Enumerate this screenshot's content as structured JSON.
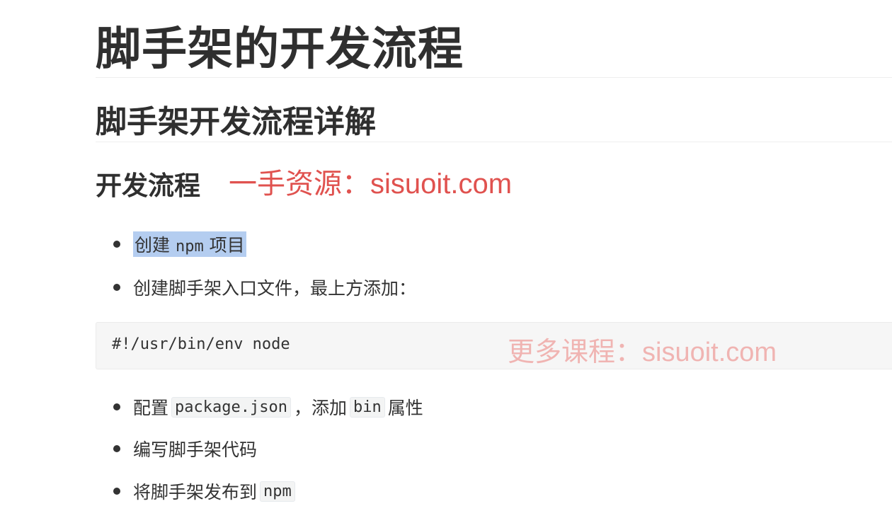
{
  "heading1": "脚手架的开发流程",
  "heading2": "脚手架开发流程详解",
  "heading3": "开发流程",
  "watermark_top": "一手资源：sisuoit.com",
  "watermark_code": "更多课程：sisuoit.com",
  "code_block": "#!/usr/bin/env node",
  "steps": [
    {
      "prefix": "创建",
      "code": "npm",
      "suffix": "项目"
    },
    {
      "text": "创建脚手架入口文件，最上方添加："
    },
    {
      "prefix": "配置",
      "code1": "package.json",
      "middle": "，添加",
      "code2": "bin",
      "suffix": "属性"
    },
    {
      "text": "编写脚手架代码"
    },
    {
      "prefix": "将脚手架发布到",
      "code": "npm"
    }
  ],
  "colors": {
    "watermark_top": "#e0524f",
    "watermark_code": "#f0b4b2",
    "selection": "#b4cdf0",
    "text": "#333333"
  }
}
